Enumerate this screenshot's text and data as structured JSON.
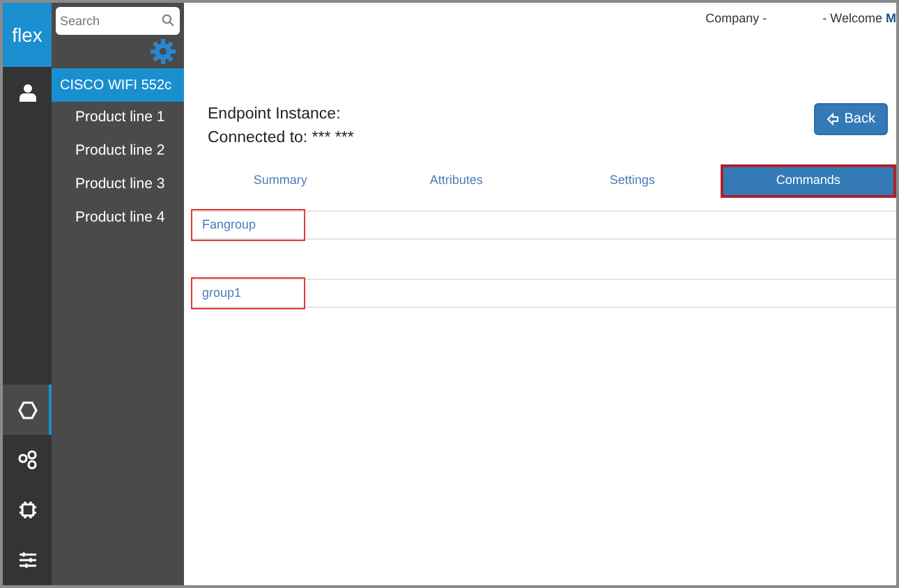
{
  "logo": "flex",
  "rail": [
    {
      "kind": "user",
      "selected": false
    },
    {
      "kind": "hexagon",
      "selected": true
    },
    {
      "kind": "circles",
      "selected": false
    },
    {
      "kind": "chip",
      "selected": false
    },
    {
      "kind": "sliders",
      "selected": false
    }
  ],
  "search": {
    "placeholder": "Search"
  },
  "sidebar": {
    "items": [
      {
        "label": "CISCO WIFI 552c",
        "selected": true
      },
      {
        "label": "Product line 1",
        "selected": false
      },
      {
        "label": "Product line 2",
        "selected": false
      },
      {
        "label": "Product line 3",
        "selected": false
      },
      {
        "label": "Product line 4",
        "selected": false
      }
    ]
  },
  "header": {
    "company": "Company -",
    "welcome": "- Welcome",
    "user": "M"
  },
  "endpoint": {
    "instance_label": "Endpoint Instance:",
    "connected_label": "Connected to: *** ***"
  },
  "back_button": "Back",
  "tabs": [
    {
      "label": "Summary",
      "selected": false,
      "highlighted": false
    },
    {
      "label": "Attributes",
      "selected": false,
      "highlighted": false
    },
    {
      "label": "Settings",
      "selected": false,
      "highlighted": false
    },
    {
      "label": "Commands",
      "selected": true,
      "highlighted": true
    }
  ],
  "groups": [
    {
      "label": "Fangroup",
      "highlighted": true
    },
    {
      "label": "group1",
      "highlighted": true
    }
  ]
}
